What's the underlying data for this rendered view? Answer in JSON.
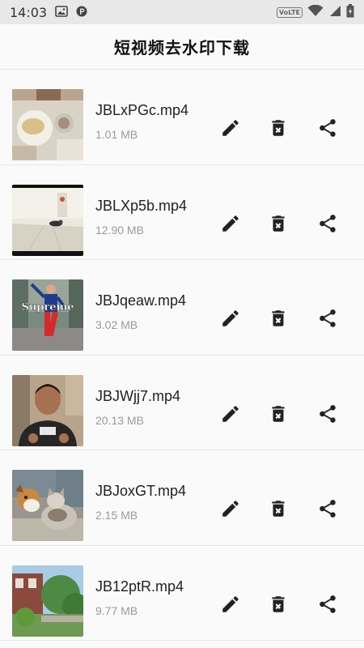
{
  "status_bar": {
    "time": "14:03",
    "network_label": "VoLTE",
    "icons": [
      "image-icon",
      "parking-icon",
      "volte-icon",
      "wifi-icon",
      "signal-icon",
      "battery-icon"
    ]
  },
  "app_bar": {
    "title": "短视频去水印下载"
  },
  "videos": [
    {
      "name": "JBLxPGc.mp4",
      "size": "1.01 MB"
    },
    {
      "name": "JBLXp5b.mp4",
      "size": "12.90 MB"
    },
    {
      "name": "JBJqeaw.mp4",
      "size": "3.02 MB",
      "thumb_text": "Supreme"
    },
    {
      "name": "JBJWjj7.mp4",
      "size": "20.13 MB"
    },
    {
      "name": "JBJoxGT.mp4",
      "size": "2.15 MB"
    },
    {
      "name": "JB12ptR.mp4",
      "size": "9.77 MB"
    }
  ],
  "actions": {
    "icons": [
      "edit-icon",
      "delete-icon",
      "share-icon"
    ]
  },
  "colors": {
    "icon": "#222222",
    "status_bar_bg": "#e8e8e8",
    "page_bg": "#fafafa",
    "secondary_text": "#9a9a9a"
  }
}
